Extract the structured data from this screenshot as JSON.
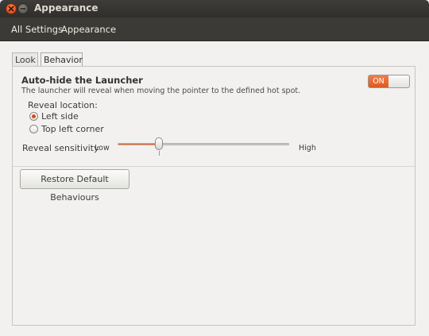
{
  "window": {
    "title": "Appearance",
    "close_icon": "close-icon",
    "minimize_icon": "minimize-icon",
    "accent_color": "#dd4814"
  },
  "breadcrumb": {
    "all_settings": "All Settings",
    "current": "Appearance"
  },
  "tabs": [
    {
      "label": "Look",
      "active": false
    },
    {
      "label": "Behavior",
      "active": true
    }
  ],
  "autohide": {
    "heading": "Auto-hide the Launcher",
    "description": "The launcher will reveal when moving the pointer to the defined hot spot.",
    "toggle_label": "ON",
    "toggle_state": true
  },
  "reveal_location": {
    "label": "Reveal location:",
    "options": [
      {
        "label": "Left side",
        "selected": true
      },
      {
        "label": "Top left corner",
        "selected": false
      }
    ]
  },
  "reveal_sensitivity": {
    "label": "Reveal sensitivity",
    "low_label": "Low",
    "high_label": "High",
    "value": 0.24
  },
  "restore_button": {
    "label": "Restore Default Behaviours"
  }
}
